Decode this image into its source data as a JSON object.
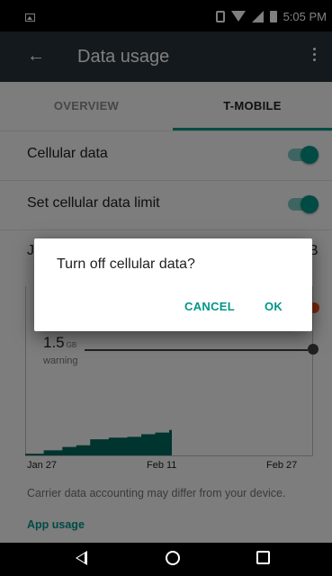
{
  "status_bar": {
    "time": "5:05 PM",
    "icons": [
      "screenshot-icon",
      "vibrate-icon",
      "wifi-icon",
      "cell-signal-icon",
      "battery-icon"
    ]
  },
  "app_bar": {
    "title": "Data usage",
    "color": "#263238"
  },
  "tabs": [
    {
      "label": "OVERVIEW",
      "selected": false
    },
    {
      "label": "T-MOBILE",
      "selected": true
    }
  ],
  "settings": {
    "cellular_data": {
      "label": "Cellular data",
      "enabled": true
    },
    "data_limit": {
      "label": "Set cellular data limit",
      "enabled": true
    }
  },
  "cycle": {
    "left_text": "J",
    "right_text": "B"
  },
  "chart": {
    "warning_value": "1.5",
    "warning_unit": "GB",
    "warning_label": "warning",
    "ticks": [
      "Jan 27",
      "Feb 11",
      "Feb 27"
    ]
  },
  "chart_data": {
    "type": "area",
    "x": [
      0,
      4,
      8,
      11,
      14,
      18,
      22,
      25,
      28,
      31
    ],
    "values": [
      0.02,
      0.06,
      0.1,
      0.12,
      0.19,
      0.21,
      0.22,
      0.25,
      0.27,
      0.3
    ],
    "ylim": [
      0,
      2.0
    ],
    "xlim": [
      0,
      62
    ],
    "warning_level": 1.5,
    "accent": "#00695c"
  },
  "footer": {
    "disclaimer": "Carrier data accounting may differ from your device.",
    "app_usage": "App usage"
  },
  "dialog": {
    "title": "Turn off cellular data?",
    "cancel": "CANCEL",
    "ok": "OK"
  },
  "colors": {
    "accent": "#009688",
    "limit": "#f4511e"
  }
}
